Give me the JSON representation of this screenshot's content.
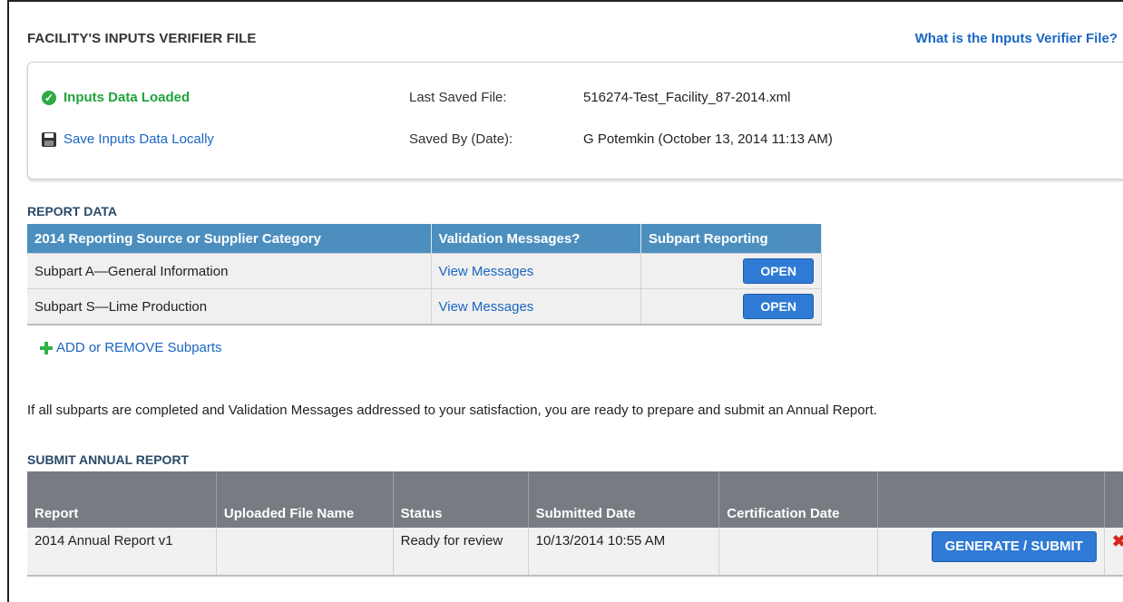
{
  "header": {
    "title": "FACILITY'S INPUTS VERIFIER FILE",
    "help_link": "What is the Inputs Verifier File?"
  },
  "inputs_box": {
    "status": "Inputs Data Loaded",
    "save_action": "Save Inputs Data Locally",
    "last_saved_label": "Last Saved File:",
    "last_saved_value": "516274-Test_Facility_87-2014.xml",
    "saved_by_label": "Saved By (Date):",
    "saved_by_value": "G Potemkin (October 13, 2014 11:13 AM)"
  },
  "report_data": {
    "section_label": "REPORT DATA",
    "columns": [
      "2014 Reporting Source or Supplier Category",
      "Validation Messages?",
      "Subpart Reporting"
    ],
    "rows": [
      {
        "category": "Subpart A—General Information",
        "validation": "View Messages",
        "action": "OPEN"
      },
      {
        "category": "Subpart S—Lime Production",
        "validation": "View Messages",
        "action": "OPEN"
      }
    ],
    "add_remove": "ADD or REMOVE Subparts"
  },
  "info_text": "If all subparts are completed and Validation Messages addressed to your satisfaction, you are ready to prepare and submit an Annual Report.",
  "submit": {
    "section_label": "SUBMIT ANNUAL REPORT",
    "columns": [
      "Report",
      "Uploaded File Name",
      "Status",
      "Submitted Date",
      "Certification Date",
      "",
      ""
    ],
    "rows": [
      {
        "report": "2014 Annual Report v1",
        "file": "",
        "status": "Ready for review",
        "submitted": "10/13/2014 10:55 AM",
        "certification": "",
        "action": "GENERATE / SUBMIT"
      }
    ]
  },
  "colors": {
    "accent_blue": "#1a66c2",
    "table_header_blue": "#4c8fbf",
    "table_header_gray": "#777c82",
    "success_green": "#1fa33a",
    "delete_red": "#d9261c"
  },
  "icons": [
    "check-circle-icon",
    "floppy-disk-icon",
    "plus-icon",
    "delete-x-icon"
  ]
}
